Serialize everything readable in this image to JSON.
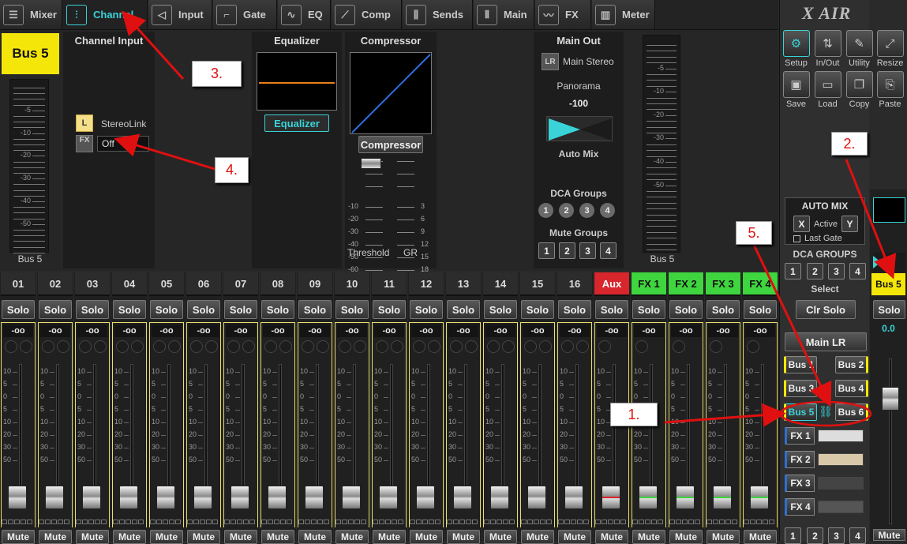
{
  "tabs": [
    {
      "label": "Mixer",
      "icon": "mixer-icon"
    },
    {
      "label": "Channel",
      "icon": "channel-icon"
    },
    {
      "label": "Input",
      "icon": "input-icon"
    },
    {
      "label": "Gate",
      "icon": "gate-icon"
    },
    {
      "label": "EQ",
      "icon": "eq-icon"
    },
    {
      "label": "Comp",
      "icon": "comp-icon"
    },
    {
      "label": "Sends",
      "icon": "sends-icon"
    },
    {
      "label": "Main",
      "icon": "main-icon"
    },
    {
      "label": "FX",
      "icon": "fx-icon"
    },
    {
      "label": "Meter",
      "icon": "meter-icon"
    }
  ],
  "channel": {
    "name": "Bus 5",
    "meter_label": "Bus 5",
    "meter_scale": [
      "-5",
      "-10",
      "-20",
      "-30",
      "-40",
      "-50"
    ],
    "input": {
      "title": "Channel Input",
      "l_badge": "L",
      "stereolink_label": "StereoLink",
      "fx_badge": "FX",
      "fx_value": "Off"
    },
    "eq": {
      "title": "Equalizer",
      "button": "Equalizer"
    },
    "comp": {
      "title": "Compressor",
      "button": "Compressor",
      "threshold_label": "Threshold",
      "gr_label": "GR",
      "thr_scale": [
        "-10",
        "-20",
        "-30",
        "-40",
        "-50",
        "-60"
      ],
      "gr_scale": [
        "3",
        "6",
        "9",
        "12",
        "15",
        "18"
      ]
    },
    "main_out": {
      "title": "Main Out",
      "lr_badge": "LR",
      "lr_label": "Main Stereo",
      "panorama_label": "Panorama",
      "panorama_value": "-100",
      "automix_label": "Auto Mix",
      "dca_title": "DCA Groups",
      "dca": [
        "1",
        "2",
        "3",
        "4"
      ],
      "mute_title": "Mute Groups",
      "mute": [
        "1",
        "2",
        "3",
        "4"
      ]
    },
    "right_meter_label": "Bus 5"
  },
  "strips": [
    {
      "name": "01",
      "color": ""
    },
    {
      "name": "02",
      "color": ""
    },
    {
      "name": "03",
      "color": ""
    },
    {
      "name": "04",
      "color": ""
    },
    {
      "name": "05",
      "color": ""
    },
    {
      "name": "06",
      "color": ""
    },
    {
      "name": "07",
      "color": ""
    },
    {
      "name": "08",
      "color": ""
    },
    {
      "name": "09",
      "color": ""
    },
    {
      "name": "10",
      "color": ""
    },
    {
      "name": "11",
      "color": ""
    },
    {
      "name": "12",
      "color": ""
    },
    {
      "name": "13",
      "color": ""
    },
    {
      "name": "14",
      "color": ""
    },
    {
      "name": "15",
      "color": ""
    },
    {
      "name": "16",
      "color": ""
    },
    {
      "name": "Aux",
      "color": "red"
    },
    {
      "name": "FX 1",
      "color": "green"
    },
    {
      "name": "FX 2",
      "color": "green"
    },
    {
      "name": "FX 3",
      "color": "green"
    },
    {
      "name": "FX 4",
      "color": "green"
    }
  ],
  "strip_common": {
    "solo": "Solo",
    "gain": "-oo",
    "mute": "Mute",
    "fader_scale": [
      "10",
      "5",
      "0",
      "5",
      "10",
      "20",
      "30",
      "50"
    ]
  },
  "right_panel": {
    "logo": "X AIR",
    "tools": [
      "Setup",
      "In/Out",
      "Utility",
      "Resize",
      "Save",
      "Load",
      "Copy",
      "Paste"
    ],
    "automix": {
      "title": "AUTO MIX",
      "x": "X",
      "active": "Active",
      "y": "Y",
      "last_gate": "Last Gate"
    },
    "dca_title": "DCA GROUPS",
    "dca": [
      "1",
      "2",
      "3",
      "4"
    ],
    "select_label": "Select",
    "clr_solo": "Clr Solo",
    "main_lr": "Main LR",
    "buses": [
      "Bus 1",
      "Bus 2",
      "Bus 3",
      "Bus 4",
      "Bus 5",
      "Bus 6"
    ],
    "fx": [
      "FX 1",
      "FX 2",
      "FX 3",
      "FX 4"
    ],
    "bottom_nums": [
      "1",
      "2",
      "3",
      "4"
    ]
  },
  "selected_strip": {
    "name": "Bus 5",
    "solo": "Solo",
    "value": "0.0",
    "mute": "Mute"
  },
  "annotations": [
    "1.",
    "2.",
    "3.",
    "4.",
    "5."
  ],
  "colors": {
    "accent": "#39d3d8",
    "bus_yellow": "#f5e60a",
    "fx_green": "#3ed53e",
    "aux_red": "#d8262d",
    "arrow_red": "#e01010"
  }
}
